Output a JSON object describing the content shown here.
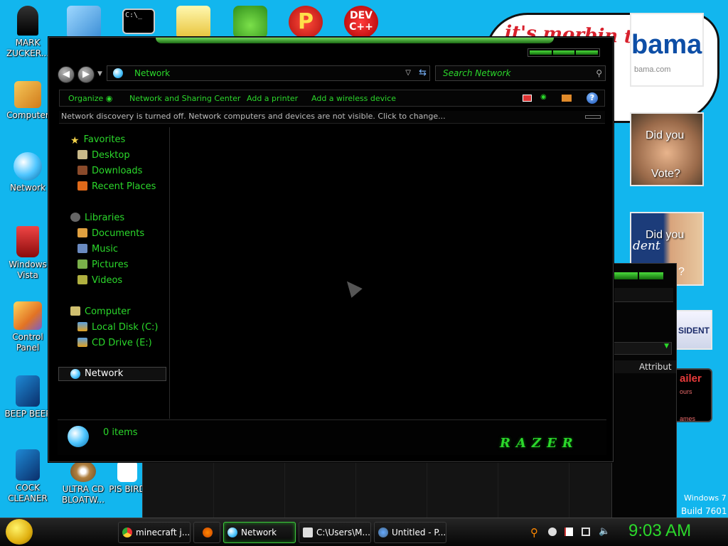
{
  "desktop": {
    "left_icons": [
      {
        "label": "MARK ZUCKER...",
        "icon": "person-icon"
      },
      {
        "label": "Computer",
        "icon": "computer-icon"
      },
      {
        "label": "Network",
        "icon": "network-globe-icon"
      },
      {
        "label": "Windows Vista",
        "icon": "recycle-bin-icon"
      },
      {
        "label": "Control Panel",
        "icon": "control-panel-icon"
      },
      {
        "label": "BEEP BEEP",
        "icon": "blue-panel-icon"
      },
      {
        "label": "COCK CLEANER",
        "icon": "blue-panel-icon"
      }
    ],
    "bottom_icons": [
      {
        "label": "ULTRA CD BLOATW..."
      },
      {
        "label": "PIS BIRD"
      }
    ],
    "top_icons": [
      "notes-icon",
      "cmd-icon",
      "folder-icon",
      "bad-piggies-icon",
      "p-app-icon",
      "dev-cpp-icon"
    ],
    "top_icon_text": {
      "dev": "DEV",
      "cpp": "C++",
      "p": "P",
      "cmd": "C:\\_"
    },
    "bubble_text": "it's morbin t",
    "tiles": {
      "obama": {
        "big": "bama",
        "small": "bama.com"
      },
      "vote1": {
        "line1": "Did you",
        "line2": "Vote?"
      },
      "vote2": {
        "line1": "Did you",
        "line2": "dent",
        "line3": "?"
      },
      "president": "SIDENT",
      "trailer": {
        "title": "ailer",
        "sub": "ours",
        "foot": "ames"
      }
    },
    "build": {
      "line1": "Windows 7",
      "line2": "Build 7601"
    },
    "bg_window": {
      "column": "Attribut"
    }
  },
  "explorer": {
    "address": "Network",
    "search_placeholder": "Search Network",
    "toolbar": {
      "organize": "Organize",
      "sharing": "Network and Sharing Center",
      "printer": "Add a printer",
      "wireless": "Add a wireless device",
      "help": "?"
    },
    "info_bar": "Network discovery is turned off. Network computers and devices are not visible. Click to change...",
    "nav": {
      "favorites": "Favorites",
      "desktop": "Desktop",
      "downloads": "Downloads",
      "recent": "Recent Places",
      "libraries": "Libraries",
      "documents": "Documents",
      "music": "Music",
      "pictures": "Pictures",
      "videos": "Videos",
      "computer": "Computer",
      "local_disk": "Local Disk (C:)",
      "cd_drive": "CD Drive (E:)",
      "network": "Network"
    },
    "status": "0 items",
    "brand": "RAZER"
  },
  "taskbar": {
    "buttons": [
      {
        "label": "minecraft j...",
        "icon": "chrome-icon"
      },
      {
        "label": "",
        "icon": "firefox-icon"
      },
      {
        "label": "Network",
        "icon": "network-icon"
      },
      {
        "label": "C:\\Users\\M...",
        "icon": "filezilla-icon"
      },
      {
        "label": "Untitled - P...",
        "icon": "paint-icon"
      }
    ],
    "clock": "9:03 AM"
  },
  "colors": {
    "accent_green": "#2bd82b",
    "desktop_blue": "#12b6ee",
    "window_black": "#000000"
  }
}
